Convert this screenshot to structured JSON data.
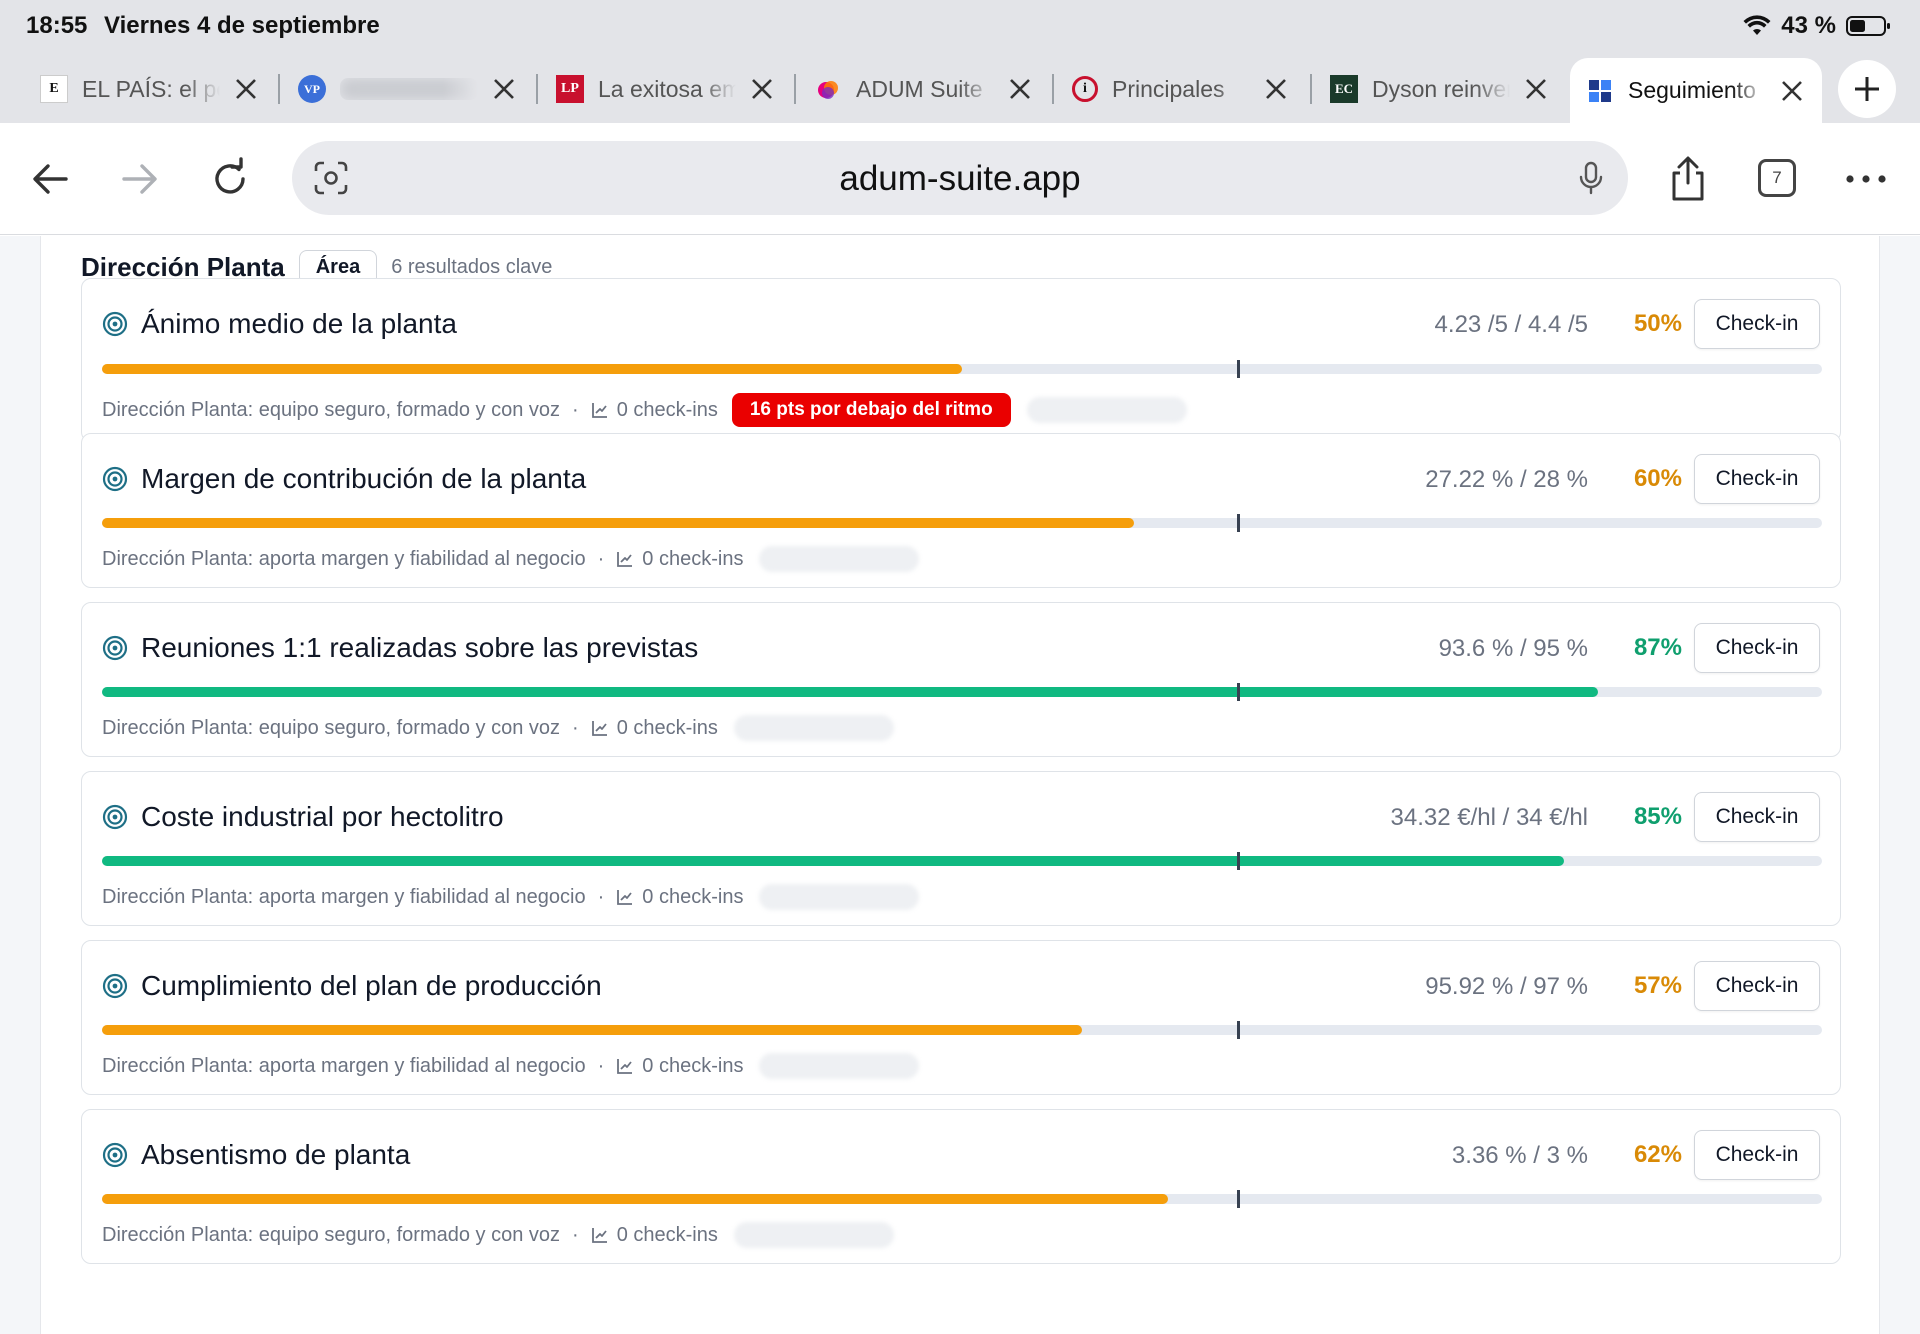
{
  "status": {
    "time": "18:55",
    "date": "Viernes 4 de septiembre",
    "battery": "43 %"
  },
  "tabs": [
    {
      "title": "EL PAÍS: el periódico",
      "favicon": "E"
    },
    {
      "title": "",
      "favicon": "VP"
    },
    {
      "title": "La exitosa empresa",
      "favicon": "LP"
    },
    {
      "title": "ADUM Suite",
      "favicon": ""
    },
    {
      "title": "Principales",
      "favicon": "i"
    },
    {
      "title": "Dyson reinventa",
      "favicon": "EC"
    },
    {
      "title": "Seguimiento",
      "favicon": ""
    }
  ],
  "toolbar": {
    "url": "adum-suite.app",
    "tab_count": "7"
  },
  "group": {
    "title": "Dirección Planta",
    "badge": "Área",
    "count": "6 resultados clave"
  },
  "colors": {
    "orange": "#f59e0b",
    "green": "#10b981",
    "orange_text": "#d98a06",
    "green_text": "#0f9f6e",
    "alert": "#ea0000"
  },
  "key_results": [
    {
      "title": "Ánimo medio de la planta",
      "values": "4.23 /5 / 4.4 /5",
      "pct": "50%",
      "progress": 0.5,
      "status": "warn",
      "meta": "Dirección Planta: equipo seguro, formado y con voz",
      "checkins": "0 check-ins",
      "alert": "16 pts por debajo del ritmo"
    },
    {
      "title": "Margen de contribución de la planta",
      "values": "27.22 % / 28 %",
      "pct": "60%",
      "progress": 0.6,
      "status": "warn",
      "meta": "Dirección Planta: aporta margen y fiabilidad al negocio",
      "checkins": "0 check-ins",
      "alert": ""
    },
    {
      "title": "Reuniones 1:1 realizadas sobre las previstas",
      "values": "93.6 % / 95 %",
      "pct": "87%",
      "progress": 0.87,
      "status": "ok",
      "meta": "Dirección Planta: equipo seguro, formado y con voz",
      "checkins": "0 check-ins",
      "alert": ""
    },
    {
      "title": "Coste industrial por hectolitro",
      "values": "34.32 €/hl / 34 €/hl",
      "pct": "85%",
      "progress": 0.85,
      "status": "ok",
      "meta": "Dirección Planta: aporta margen y fiabilidad al negocio",
      "checkins": "0 check-ins",
      "alert": ""
    },
    {
      "title": "Cumplimiento del plan de producción",
      "values": "95.92 % / 97 %",
      "pct": "57%",
      "progress": 0.57,
      "status": "warn",
      "meta": "Dirección Planta: aporta margen y fiabilidad al negocio",
      "checkins": "0 check-ins",
      "alert": ""
    },
    {
      "title": "Absentismo de planta",
      "values": "3.36 % / 3 %",
      "pct": "62%",
      "progress": 0.62,
      "status": "warn",
      "meta": "Dirección Planta: equipo seguro, formado y con voz",
      "checkins": "0 check-ins",
      "alert": ""
    }
  ],
  "pace_marker": 0.66,
  "checkin_label": "Check-in"
}
